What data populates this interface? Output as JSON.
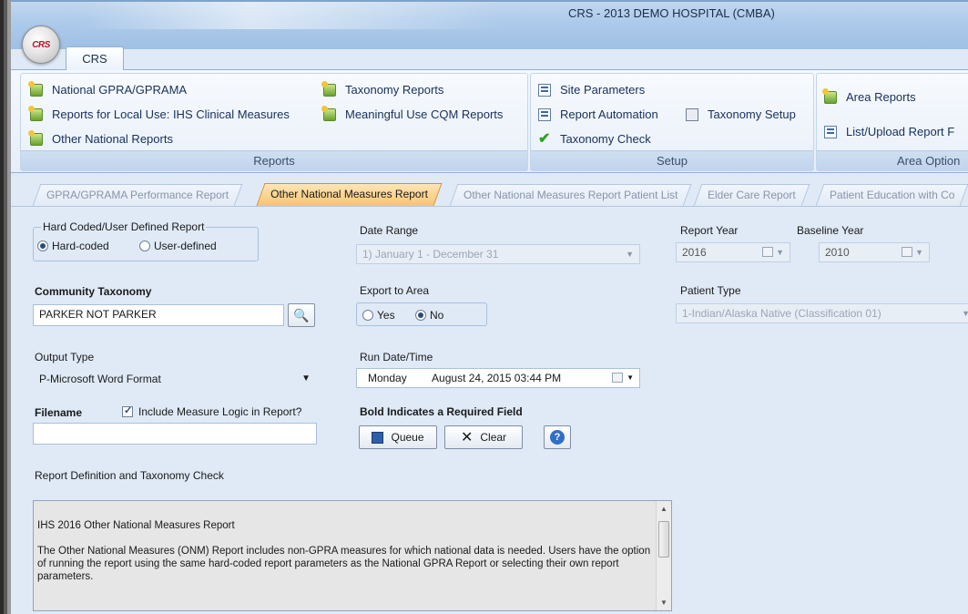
{
  "window": {
    "title": "CRS - 2013 DEMO HOSPITAL (CMBA)",
    "app_logo_text": "CRS"
  },
  "ribbon": {
    "tab_label": "CRS",
    "groups": {
      "reports": {
        "label": "Reports",
        "items": [
          "National GPRA/GPRAMA",
          "Reports for Local Use: IHS Clinical Measures",
          "Other National Reports",
          "Taxonomy Reports",
          "Meaningful Use CQM Reports"
        ]
      },
      "setup": {
        "label": "Setup",
        "items": [
          "Site Parameters",
          "Report Automation",
          "Taxonomy Check",
          "Taxonomy Setup"
        ]
      },
      "area": {
        "label": "Area Option",
        "items": [
          "Area Reports",
          "List/Upload Report F"
        ]
      }
    }
  },
  "tabs": [
    "GPRA/GPRAMA Performance Report",
    "Other National Measures Report",
    "Other National Measures Report Patient List",
    "Elder Care Report",
    "Patient Education with Co"
  ],
  "form": {
    "report_type": {
      "legend": "Hard Coded/User Defined Report",
      "opt1": "Hard-coded",
      "opt2": "User-defined",
      "selected": "Hard-coded"
    },
    "date_range": {
      "label": "Date Range",
      "value": "1) January 1 - December 31"
    },
    "report_year": {
      "label": "Report Year",
      "value": "2016"
    },
    "baseline_year": {
      "label": "Baseline Year",
      "value": "2010"
    },
    "community_taxonomy": {
      "label": "Community Taxonomy",
      "value": "PARKER NOT PARKER"
    },
    "export_to_area": {
      "label": "Export to Area",
      "yes": "Yes",
      "no": "No",
      "selected": "No"
    },
    "patient_type": {
      "label": "Patient Type",
      "value": "1-Indian/Alaska Native (Classification 01)"
    },
    "output_type": {
      "label": "Output Type",
      "value": "P-Microsoft Word Format"
    },
    "run_datetime": {
      "label": "Run Date/Time",
      "day": "Monday",
      "date": "August  24, 2015  03:44 PM"
    },
    "filename": {
      "label": "Filename",
      "value": ""
    },
    "include_logic": {
      "label": "Include Measure Logic in Report?",
      "checked": true
    },
    "required_note": "Bold Indicates a Required Field",
    "queue_label": "Queue",
    "clear_label": "Clear",
    "definition_label": "Report Definition and Taxonomy Check",
    "definition_title": "IHS 2016 Other National Measures Report",
    "definition_body": "The Other National Measures (ONM) Report includes non-GPRA measures for which national data is needed.  Users have the option of running the report using the same hard-coded report parameters as the National GPRA Report or selecting their own report parameters."
  },
  "colors": {
    "active_tab": "#f7c56f",
    "ribbon_blue": "#c0d4ec",
    "window_bg": "#dfeaf6"
  }
}
